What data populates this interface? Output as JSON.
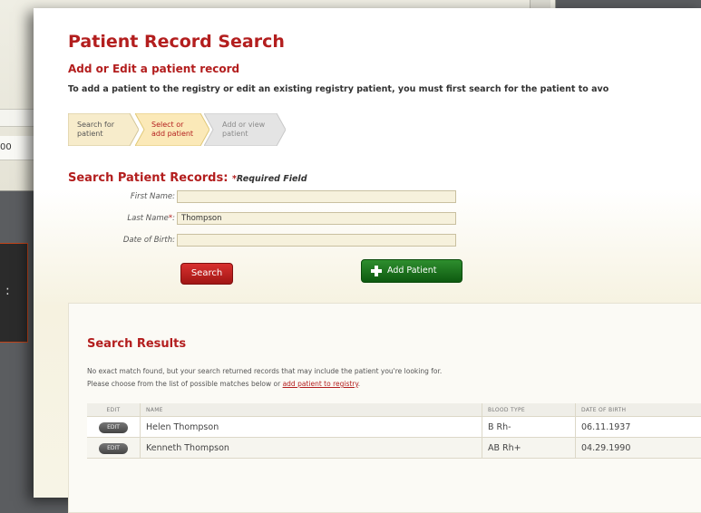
{
  "background": {
    "fragment_text": "00"
  },
  "page": {
    "title": "Patient Record Search",
    "subtitle": "Add or Edit a patient record",
    "intro": "To add a patient to the registry or edit an existing registry patient, you must first search for the patient to avo"
  },
  "steps": [
    {
      "line1": "Search for",
      "line2": "patient",
      "state": "done"
    },
    {
      "line1": "Select or",
      "line2": "add patient",
      "state": "current"
    },
    {
      "line1": "Add or view",
      "line2": "patient",
      "state": "pending"
    }
  ],
  "search_form": {
    "heading": "Search Patient Records:",
    "required_star": "*",
    "required_note": "Required Field",
    "first_name_label": "First Name:",
    "first_name_value": "",
    "last_name_label": "Last Name",
    "last_name_star": "*",
    "last_name_colon": ":",
    "last_name_value": "Thompson",
    "dob_label": "Date of Birth:",
    "dob_value": "",
    "search_button": "Search",
    "add_patient_button": "Add Patient"
  },
  "results": {
    "title": "Search Results",
    "message_line1": "No exact match found, but your search returned records that may include the patient you're looking for.",
    "message_line2_prefix": "Please choose from the list of possible matches below or ",
    "message_link": "add patient to registry",
    "message_line2_suffix": ".",
    "columns": [
      "EDIT",
      "NAME",
      "BLOOD TYPE",
      "DATE OF BIRTH"
    ],
    "edit_label": "EDIT",
    "rows": [
      {
        "name": "Helen Thompson",
        "blood_type": "B Rh-",
        "dob": "06.11.1937"
      },
      {
        "name": "Kenneth Thompson",
        "blood_type": "AB Rh+",
        "dob": "04.29.1990"
      }
    ]
  },
  "colors": {
    "accent_red": "#b31e1e",
    "add_green": "#1e7a1e"
  }
}
